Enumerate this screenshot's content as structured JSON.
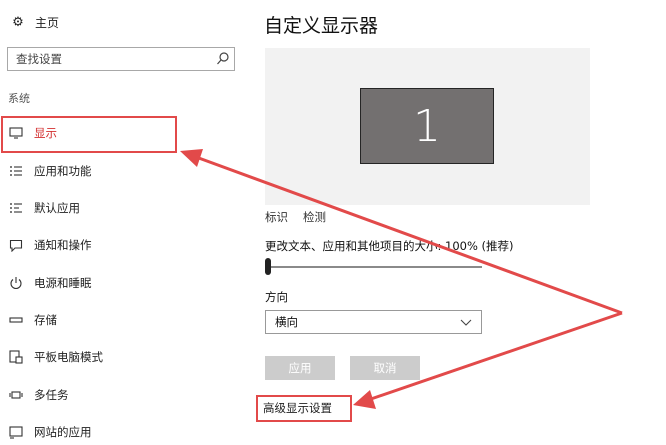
{
  "sidebar": {
    "home_label": "主页",
    "search_placeholder": "查找设置",
    "section_label": "系统",
    "items": [
      {
        "label": "显示",
        "icon": "monitor-icon",
        "active": true
      },
      {
        "label": "应用和功能",
        "icon": "apps-list-icon"
      },
      {
        "label": "默认应用",
        "icon": "default-apps-icon"
      },
      {
        "label": "通知和操作",
        "icon": "notification-icon"
      },
      {
        "label": "电源和睡眠",
        "icon": "power-icon"
      },
      {
        "label": "存储",
        "icon": "storage-icon"
      },
      {
        "label": "平板电脑模式",
        "icon": "tablet-mode-icon"
      },
      {
        "label": "多任务",
        "icon": "multitask-icon"
      },
      {
        "label": "网站的应用",
        "icon": "web-apps-icon"
      }
    ]
  },
  "main": {
    "title": "自定义显示器",
    "monitor_number": "1",
    "identify_label": "标识",
    "detect_label": "检测",
    "scale_label": "更改文本、应用和其他项目的大小: 100% (推荐)",
    "scale_percent": 100,
    "orientation_label": "方向",
    "orientation_value": "横向",
    "apply_label": "应用",
    "cancel_label": "取消",
    "advanced_label": "高级显示设置"
  },
  "colors": {
    "highlight": "#e24a4a",
    "disabled_button": "#cccccc",
    "monitor_fill": "#737070"
  }
}
